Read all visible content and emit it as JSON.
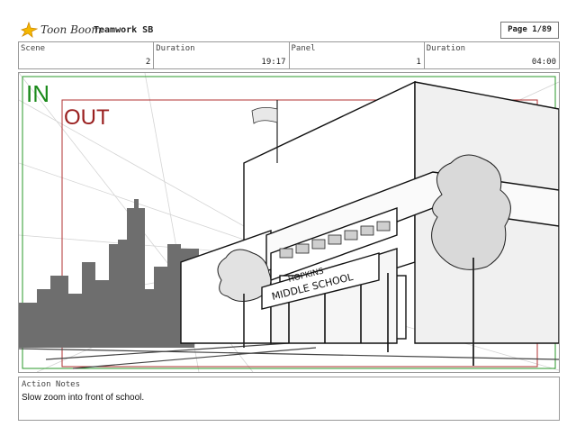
{
  "header": {
    "logo_text": "Toon Boom",
    "project_title": "Teamwork SB",
    "page_label": "Page",
    "page_value": "1/89"
  },
  "info_bar": {
    "scene_label": "Scene",
    "scene_value": "2",
    "scene_duration_label": "Duration",
    "scene_duration_value": "19:17",
    "panel_label": "Panel",
    "panel_value": "1",
    "panel_duration_label": "Duration",
    "panel_duration_value": "04:00"
  },
  "panel": {
    "in_label": "IN",
    "out_label": "OUT",
    "sign_line1": "HOPKINS",
    "sign_line2": "MIDDLE SCHOOL",
    "in_color": "#1a8a1a",
    "out_color": "#9a2020"
  },
  "notes": {
    "label": "Action Notes",
    "text": "Slow zoom into front of school."
  }
}
